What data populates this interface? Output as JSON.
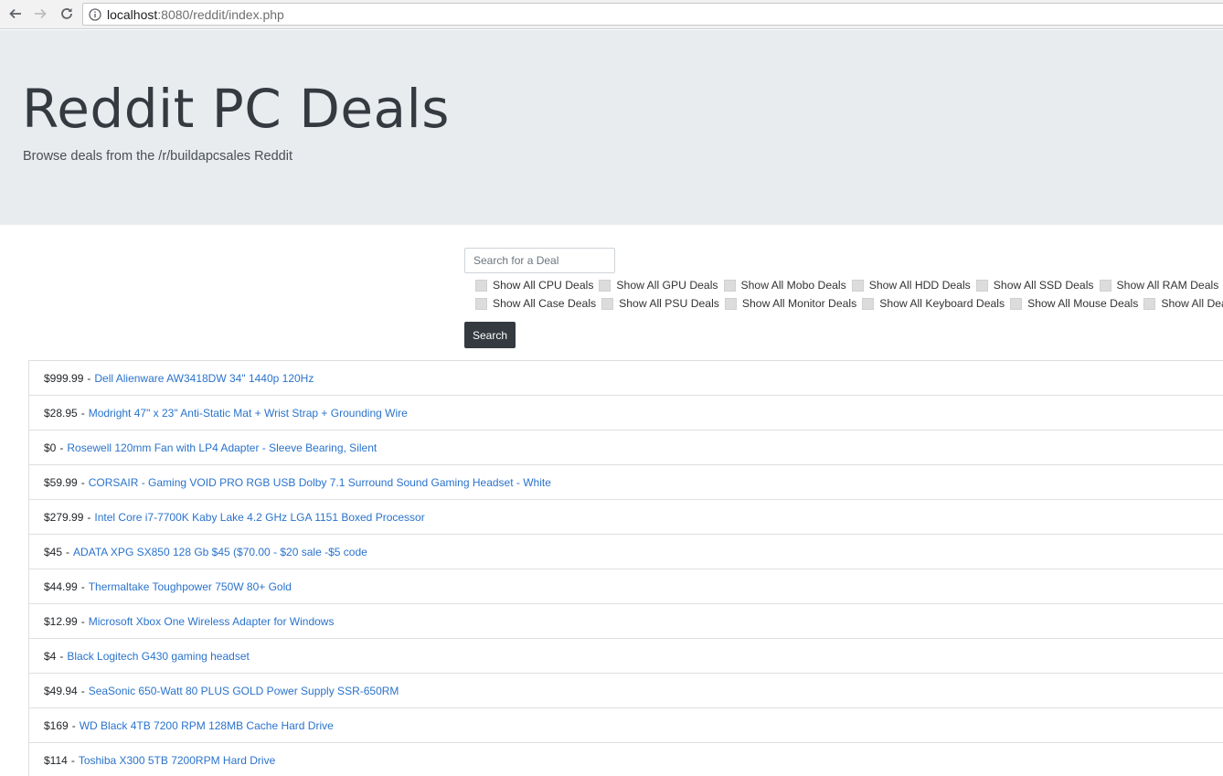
{
  "browser": {
    "url_host": "localhost",
    "url_rest": ":8080/reddit/index.php"
  },
  "header": {
    "title": "Reddit PC Deals",
    "subtitle": "Browse deals from the /r/buildapcsales Reddit"
  },
  "search": {
    "placeholder": "Search for a Deal",
    "button_label": "Search"
  },
  "filters": {
    "row1": [
      "Show All CPU Deals",
      "Show All GPU Deals",
      "Show All Mobo Deals",
      "Show All HDD Deals",
      "Show All SSD Deals",
      "Show All RAM Deals"
    ],
    "row2": [
      "Show All Case Deals",
      "Show All PSU Deals",
      "Show All Monitor Deals",
      "Show All Keyboard Deals",
      "Show All Mouse Deals",
      "Show All Deals"
    ]
  },
  "deals": [
    {
      "price": "$999.99",
      "title": "Dell Alienware AW3418DW 34\" 1440p 120Hz"
    },
    {
      "price": "$28.95",
      "title": "Modright 47\" x 23\" Anti-Static Mat + Wrist Strap + Grounding Wire"
    },
    {
      "price": "$0",
      "title": "Rosewell 120mm Fan with LP4 Adapter - Sleeve Bearing, Silent"
    },
    {
      "price": "$59.99",
      "title": "CORSAIR - Gaming VOID PRO RGB USB Dolby 7.1 Surround Sound Gaming Headset - White"
    },
    {
      "price": "$279.99",
      "title": "Intel Core i7-7700K Kaby Lake 4.2 GHz LGA 1151 Boxed Processor"
    },
    {
      "price": "$45",
      "title": "ADATA XPG SX850 128 Gb $45 ($70.00 - $20 sale -$5 code"
    },
    {
      "price": "$44.99",
      "title": "Thermaltake Toughpower 750W 80+ Gold"
    },
    {
      "price": "$12.99",
      "title": "Microsoft Xbox One Wireless Adapter for Windows"
    },
    {
      "price": "$4",
      "title": "Black Logitech G430 gaming headset"
    },
    {
      "price": "$49.94",
      "title": "SeaSonic 650-Watt 80 PLUS GOLD Power Supply SSR-650RM"
    },
    {
      "price": "$169",
      "title": "WD Black 4TB 7200 RPM 128MB Cache Hard Drive"
    },
    {
      "price": "$114",
      "title": "Toshiba X300 5TB 7200RPM Hard Drive"
    }
  ]
}
